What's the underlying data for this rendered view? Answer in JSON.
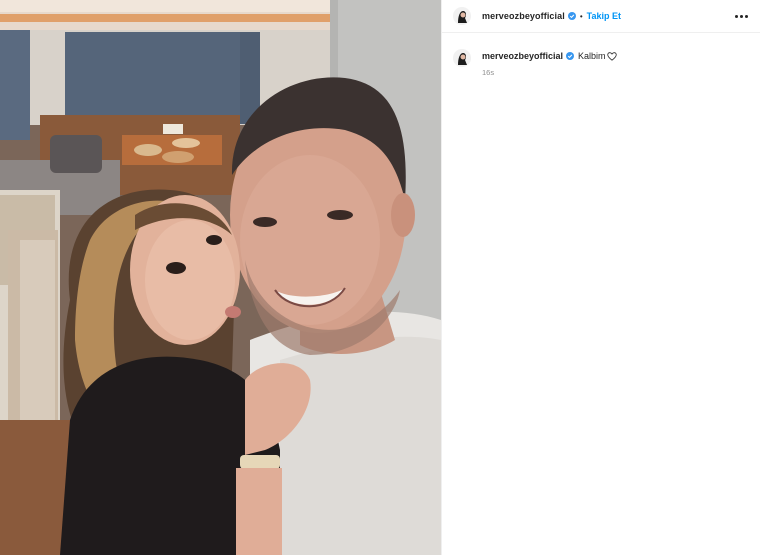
{
  "post": {
    "username": "merveozbeyofficial",
    "follow_label": "Takip Et",
    "dot": "•",
    "caption": "Kalbim",
    "time": "16s"
  },
  "colors": {
    "follow_blue": "#0095f6",
    "verified_blue": "#3897f0",
    "border": "#efefef",
    "muted": "#8e8e8e"
  },
  "icons": {
    "verified": "verified-badge-icon",
    "heart": "heart-outline-icon",
    "more": "more-options-icon"
  }
}
